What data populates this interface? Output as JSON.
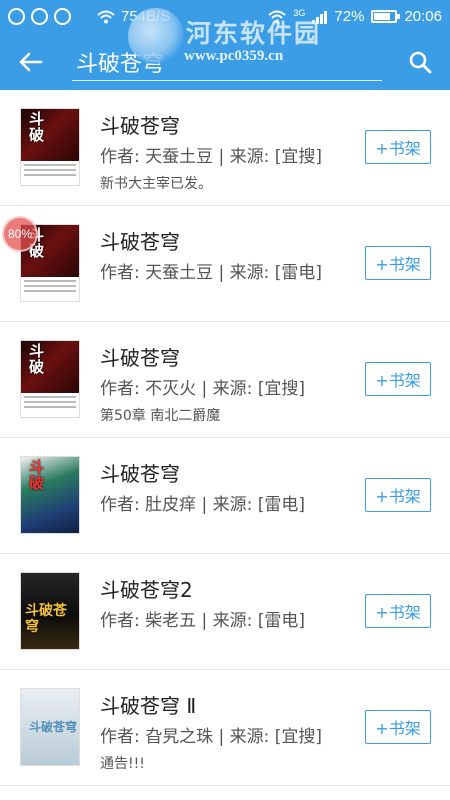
{
  "status_bar": {
    "network_speed": "754B/S",
    "network_type": "3G",
    "battery": "72%",
    "battery_level": 0.72,
    "time": "20:06"
  },
  "watermark": {
    "title": "河东软件园",
    "url": "www.pc0359.cn"
  },
  "toolbar": {
    "search_value": "斗破苍穹",
    "back_icon": "arrow-left-icon",
    "search_icon": "search-icon"
  },
  "progress_badge": "80%",
  "add_label": "+书架",
  "colors": {
    "primary": "#3a9de6",
    "divider": "#e4e4e4",
    "text": "#222222",
    "meta": "#555555"
  },
  "results": [
    {
      "title": "斗破苍穹",
      "meta": "作者: 天蚕土豆 | 来源: [宜搜]",
      "desc": "新书大主宰已发。"
    },
    {
      "title": "斗破苍穹",
      "meta": "作者: 天蚕土豆 | 来源: [雷电]",
      "desc": ""
    },
    {
      "title": "斗破苍穹",
      "meta": "作者: 不灭火 | 来源: [宜搜]",
      "desc": "第50章 南北二爵魔"
    },
    {
      "title": "斗破苍穹",
      "meta": "作者: 肚皮痒 | 来源: [雷电]",
      "desc": ""
    },
    {
      "title": "斗破苍穹2",
      "meta": "作者: 柴老五 | 来源: [雷电]",
      "desc": ""
    },
    {
      "title": "斗破苍穹 Ⅱ",
      "meta": "作者: 旮旯之珠 | 来源: [宜搜]",
      "desc": "通告!!!"
    }
  ]
}
